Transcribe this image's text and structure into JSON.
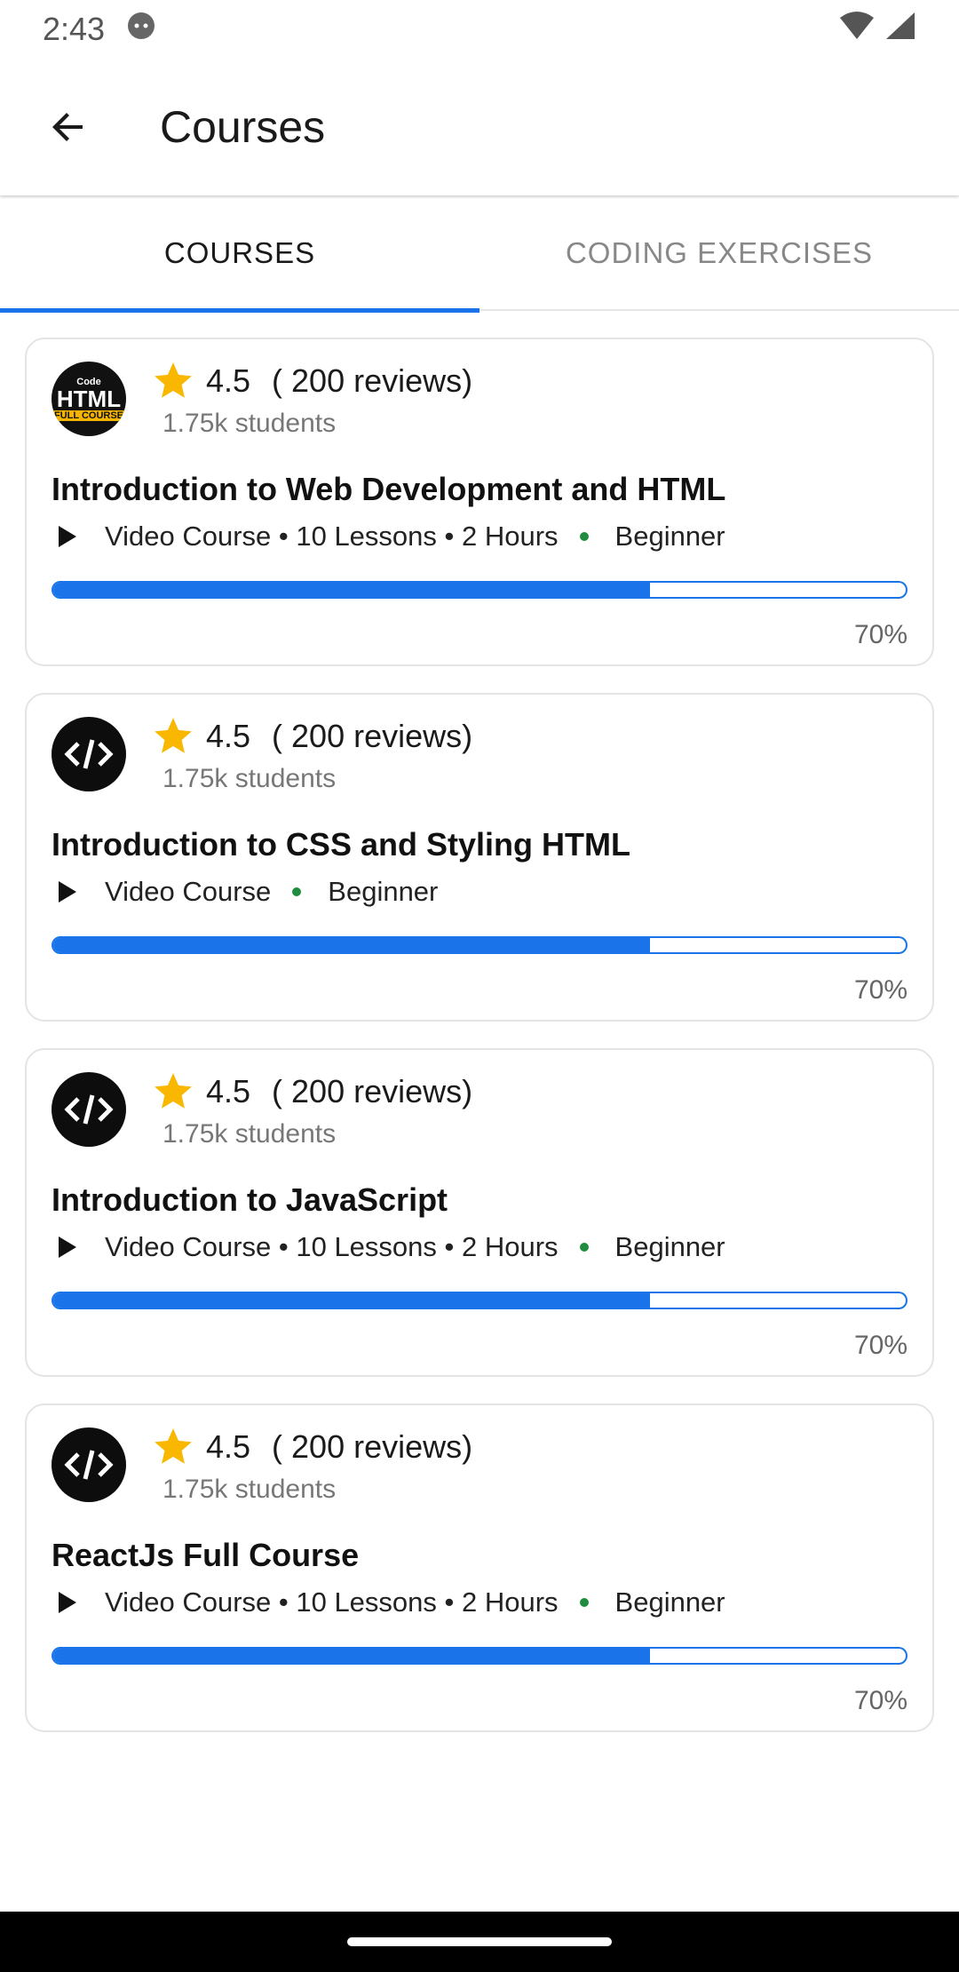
{
  "status_bar": {
    "time": "2:43",
    "icons": [
      "android-debug-icon",
      "wifi-icon",
      "cellular-signal-icon"
    ]
  },
  "app_bar": {
    "title": "Courses",
    "back_icon": "arrow-back-icon"
  },
  "tabs": [
    {
      "label": "COURSES",
      "active": true
    },
    {
      "label": "CODING EXERCISES",
      "active": false
    }
  ],
  "colors": {
    "accent": "#1a73e8",
    "star": "#f9b700",
    "level_dot": "#1e8e3e"
  },
  "courses": [
    {
      "logo": "html-full-course-logo",
      "logo_text": {
        "line1": "Code",
        "line2": "HTML",
        "line3": "FULL COURSE"
      },
      "rating": "4.5",
      "reviews": "( 200 reviews)",
      "students": "1.75k students",
      "title": "Introduction to Web Development and HTML",
      "meta": "Video Course • 10 Lessons • 2 Hours",
      "level": "Beginner",
      "progress": 0.7,
      "progress_label": "70%"
    },
    {
      "logo": "code-brackets-logo",
      "rating": "4.5",
      "reviews": "( 200 reviews)",
      "students": "1.75k students",
      "title": "Introduction to CSS and Styling HTML",
      "meta": "Video Course",
      "level": "Beginner",
      "progress": 0.7,
      "progress_label": "70%"
    },
    {
      "logo": "code-brackets-logo",
      "rating": "4.5",
      "reviews": "( 200 reviews)",
      "students": "1.75k students",
      "title": "Introduction to JavaScript",
      "meta": "Video Course • 10 Lessons • 2 Hours",
      "level": "Beginner",
      "progress": 0.7,
      "progress_label": "70%"
    },
    {
      "logo": "code-brackets-logo",
      "rating": "4.5",
      "reviews": "( 200 reviews)",
      "students": "1.75k students",
      "title": "ReactJs Full Course",
      "meta": "Video Course • 10 Lessons • 2 Hours",
      "level": "Beginner",
      "progress": 0.7,
      "progress_label": "70%"
    }
  ]
}
